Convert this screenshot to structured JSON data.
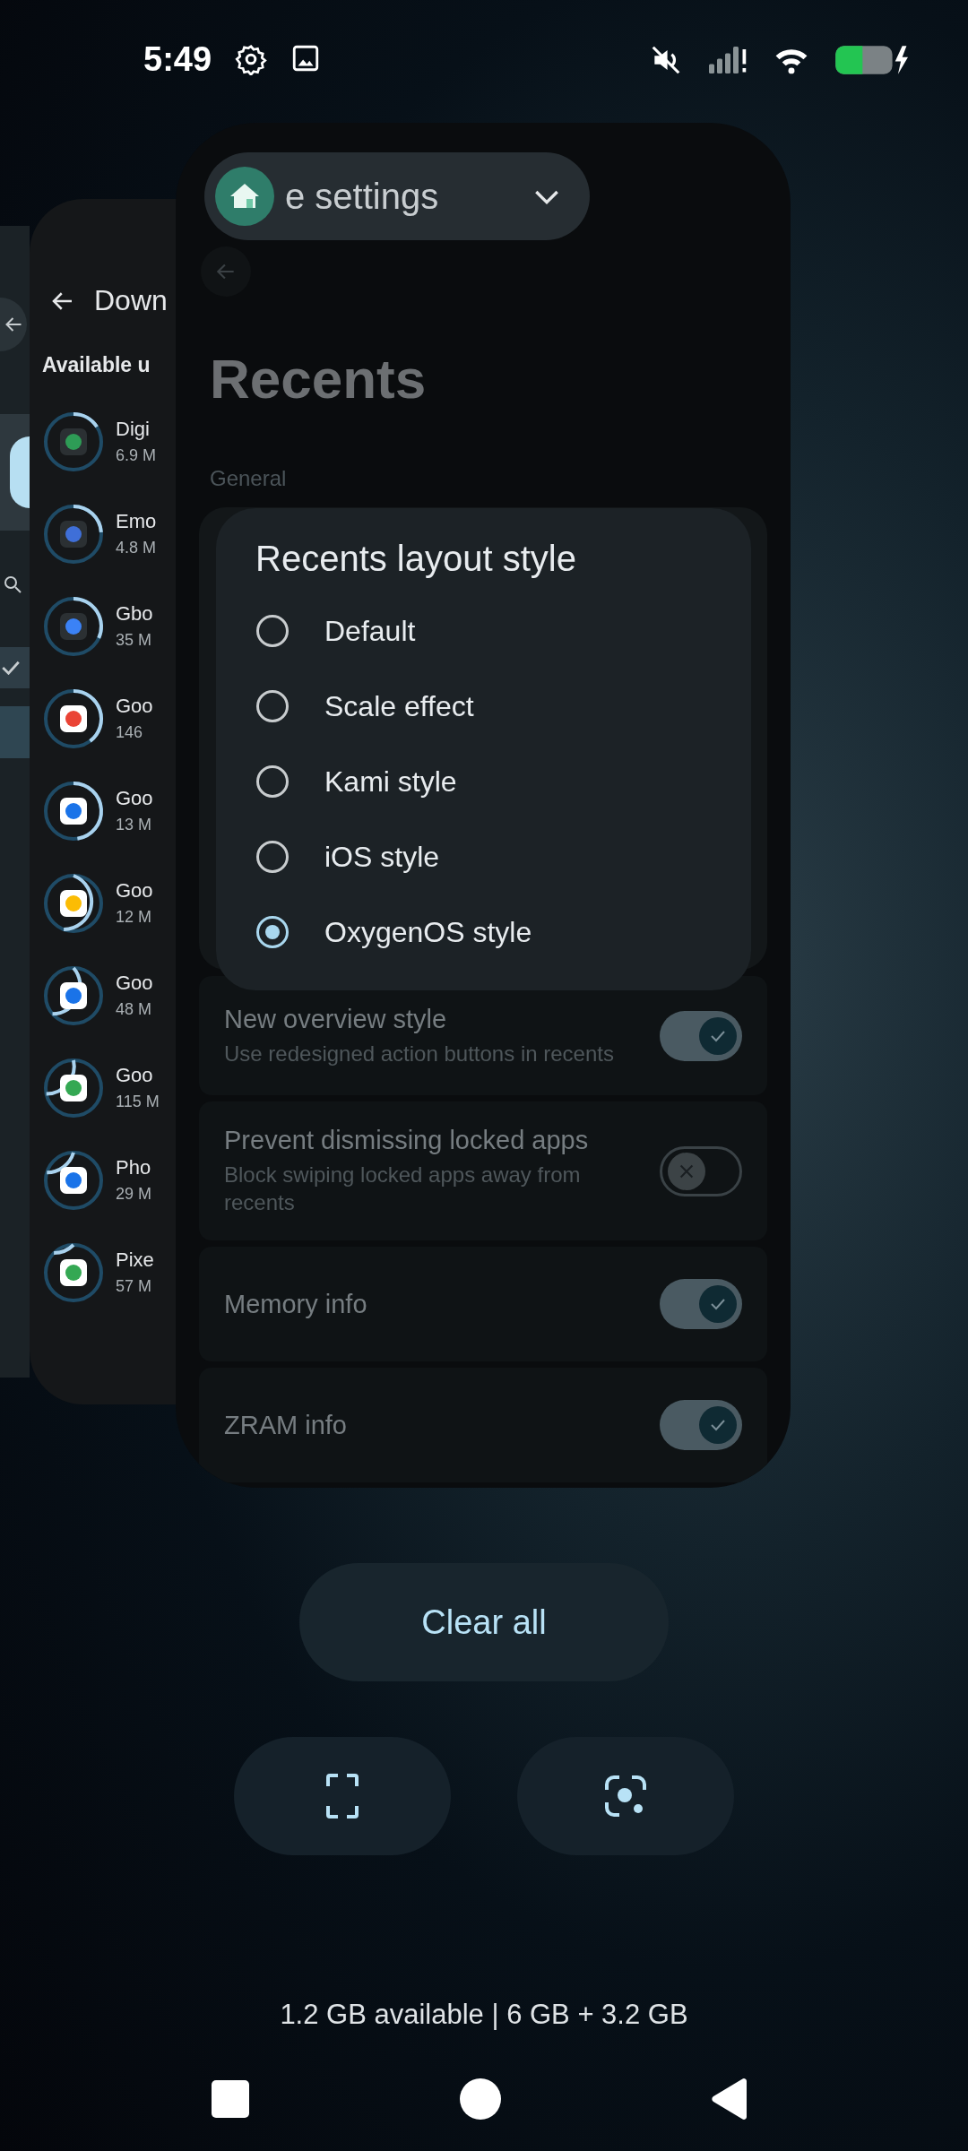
{
  "status_bar": {
    "time": "5:49"
  },
  "app_chip": {
    "label": "e settings"
  },
  "downloads_card": {
    "title": "Down",
    "section": "Available u",
    "apps": [
      {
        "name": "Digi",
        "size": "6.9 M"
      },
      {
        "name": "Emo",
        "size": "4.8 M"
      },
      {
        "name": "Gbo",
        "size": "35 M"
      },
      {
        "name": "Goo",
        "size": "146"
      },
      {
        "name": "Goo",
        "size": "13 M"
      },
      {
        "name": "Goo",
        "size": "12 M"
      },
      {
        "name": "Goo",
        "size": "48 M"
      },
      {
        "name": "Goo",
        "size": "115 M"
      },
      {
        "name": "Pho",
        "size": "29 M"
      },
      {
        "name": "Pixe",
        "size": "57 M"
      }
    ]
  },
  "settings_card": {
    "title": "Recents",
    "section": "General",
    "dialog": {
      "title": "Recents layout style",
      "options": [
        {
          "label": "Default",
          "selected": false
        },
        {
          "label": "Scale effect",
          "selected": false
        },
        {
          "label": "Kami style",
          "selected": false
        },
        {
          "label": "iOS style",
          "selected": false
        },
        {
          "label": "OxygenOS style",
          "selected": true
        }
      ]
    },
    "rows": [
      {
        "title": "New overview style",
        "subtitle": "Use redesigned action buttons in recents",
        "on": true
      },
      {
        "title": "Prevent dismissing locked apps",
        "subtitle": "Block swiping locked apps away from recents",
        "on": false
      },
      {
        "title": "Memory info",
        "on": true
      },
      {
        "title": "ZRAM info",
        "on": true
      }
    ]
  },
  "actions": {
    "clear_all": "Clear all"
  },
  "memory": "1.2 GB available | 6 GB + 3.2 GB"
}
